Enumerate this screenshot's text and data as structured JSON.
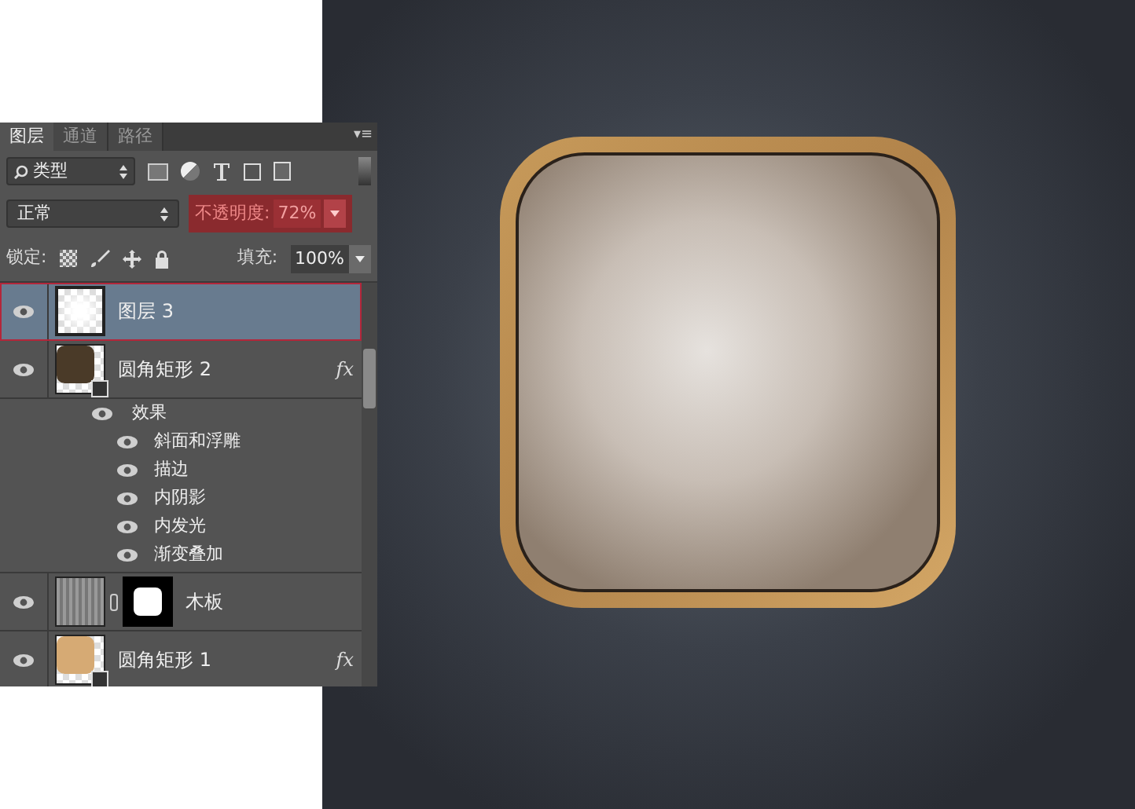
{
  "panel": {
    "tabs": [
      {
        "label": "图层",
        "selected": true
      },
      {
        "label": "通道",
        "selected": false
      },
      {
        "label": "路径",
        "selected": false
      }
    ],
    "menu_icon": "▾≡",
    "filter": {
      "value": "类型"
    },
    "blend_mode": {
      "value": "正常"
    },
    "opacity": {
      "label": "不透明度:",
      "value": "72%"
    },
    "lock": {
      "label": "锁定:"
    },
    "fill": {
      "label": "填充:",
      "value": "100%"
    },
    "layers": [
      {
        "kind": "pixel",
        "name": "图层 3",
        "selected": true,
        "visible": true
      },
      {
        "kind": "shape",
        "name": "圆角矩形 2",
        "selected": false,
        "visible": true,
        "fx": "fx",
        "effects_label": "效果",
        "effects": [
          {
            "name": "斜面和浮雕",
            "visible": true
          },
          {
            "name": "描边",
            "visible": true
          },
          {
            "name": "内阴影",
            "visible": true
          },
          {
            "name": "内发光",
            "visible": true
          },
          {
            "name": "渐变叠加",
            "visible": true
          }
        ]
      },
      {
        "kind": "masked",
        "name": "木板",
        "selected": false,
        "visible": true
      },
      {
        "kind": "shape_light",
        "name": "圆角矩形 1",
        "selected": false,
        "visible": true,
        "fx": "fx"
      }
    ]
  }
}
